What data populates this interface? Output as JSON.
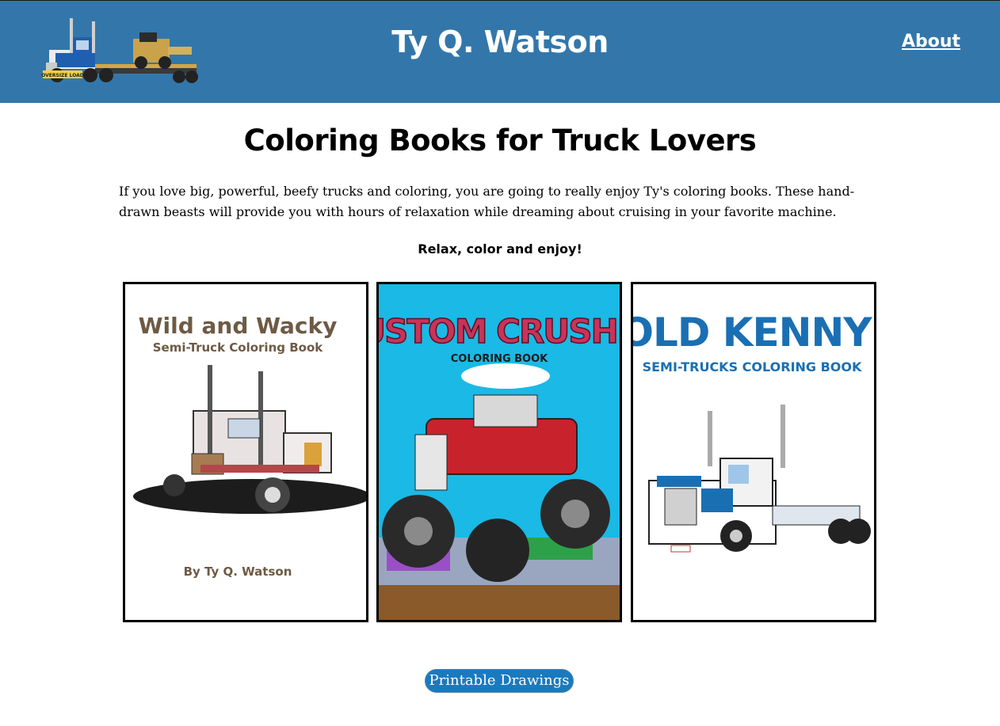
{
  "header": {
    "site_title": "Ty Q. Watson",
    "about_link": "About",
    "logo_plate": "OVERSIZE LOAD",
    "bg_color": "#3377aa"
  },
  "main": {
    "heading": "Coloring Books for Truck Lovers",
    "intro": "If you love big, powerful, beefy trucks and coloring, you are going to really enjoy Ty's coloring books. These hand-drawn beasts will provide you with hours of relaxation while dreaming about cruising in your favorite machine.",
    "tagline": "Relax, color and enjoy!"
  },
  "books": [
    {
      "title": "Wild and Wacky",
      "subtitle": "Semi-Truck Coloring Book",
      "author": "By Ty Q. Watson",
      "title_color": "#6e5a44"
    },
    {
      "title": "CUSTOM CRUSHER",
      "subtitle": "COLORING BOOK",
      "bg_color": "#1ab9e6"
    },
    {
      "title": "OLD KENNY",
      "subtitle": "SEMI-TRUCKS COLORING BOOK",
      "title_color": "#1a6fb3"
    }
  ],
  "cta": {
    "label": "Printable Drawings",
    "color": "#1a7abf"
  }
}
